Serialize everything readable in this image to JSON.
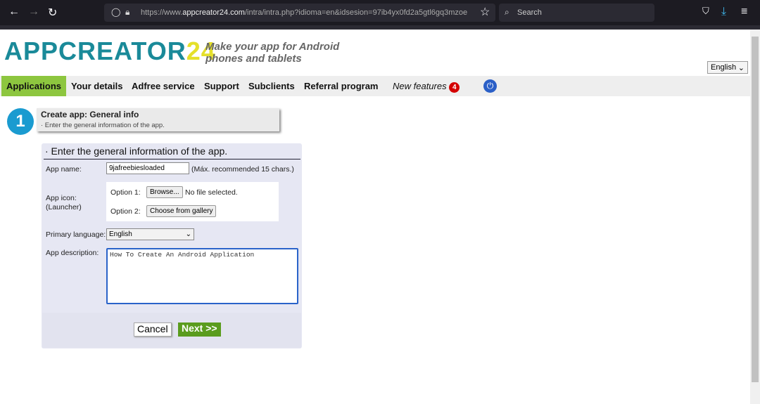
{
  "browser": {
    "url_prefix": "https://www.",
    "url_domain": "appcreator24.com",
    "url_rest": "/intra/intra.php?idioma=en&idsesion=97ib4yx0fd2a5gtl6gq3mzoe",
    "search_placeholder": "Search",
    "back": "←",
    "forward": "→",
    "reload": "↻",
    "star": "☆",
    "pocket": "⛉",
    "download": "⤓",
    "menu": "≡"
  },
  "header": {
    "logo_main": "APPCREATOR",
    "logo_num": "24",
    "tagline_1": "Make your app for Android",
    "tagline_2": "phones and tablets",
    "language": "English"
  },
  "nav": {
    "items": [
      "Applications",
      "Your details",
      "Adfree service",
      "Support",
      "Subclients",
      "Referral program"
    ],
    "new_features": "New features",
    "new_features_count": "4",
    "power": "⏻"
  },
  "step": {
    "number": "1",
    "title": "Create app: General info",
    "subtitle": "· Enter the general information of the app."
  },
  "form": {
    "title": "· Enter the general information of the app.",
    "app_name_label": "App name:",
    "app_name_value": "9jafreebiesloaded",
    "app_name_hint": "(Máx. recommended 15 chars.)",
    "app_icon_label_1": "App icon:",
    "app_icon_label_2": "(Launcher)",
    "option1_label": "Option 1:",
    "browse": "Browse...",
    "no_file": "No file selected.",
    "option2_label": "Option 2:",
    "gallery": "Choose from gallery",
    "language_label": "Primary language:",
    "language_value": "English",
    "desc_label": "App description:",
    "desc_value": "How To Create An Android Application",
    "cancel": "Cancel",
    "next": "Next >>"
  },
  "colors": {
    "accent_green": "#8dc63f",
    "next_green": "#5a9c1e",
    "step_blue": "#1a9bd0",
    "badge_red": "#d40000"
  }
}
